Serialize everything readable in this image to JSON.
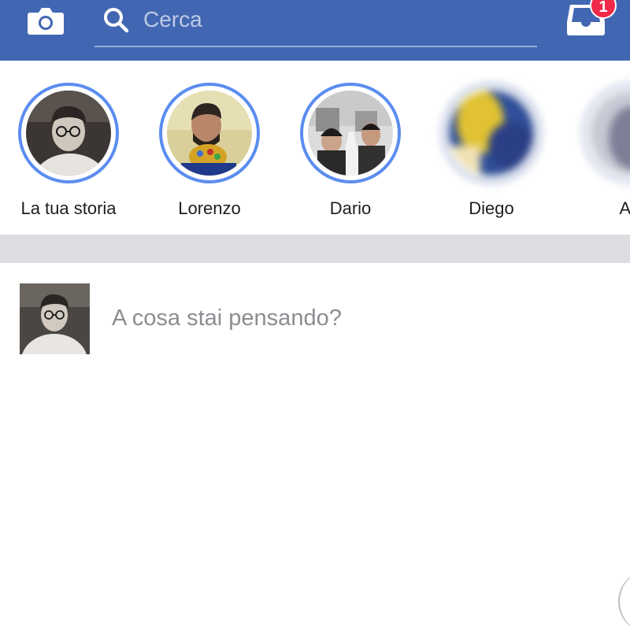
{
  "header": {
    "search": {
      "placeholder": "Cerca"
    },
    "inbox": {
      "badge_count": "1"
    },
    "colors": {
      "bar": "#4267b2",
      "badge": "#f02849"
    }
  },
  "stories": {
    "items": [
      {
        "name": "La tua storia"
      },
      {
        "name": "Lorenzo"
      },
      {
        "name": "Dario"
      },
      {
        "name": "Diego"
      },
      {
        "name": "Ant"
      }
    ],
    "ring_color": "#5b8df0"
  },
  "composer": {
    "placeholder": "A cosa stai pensando?"
  },
  "icons": [
    "camera-icon",
    "search-icon",
    "inbox-icon"
  ]
}
